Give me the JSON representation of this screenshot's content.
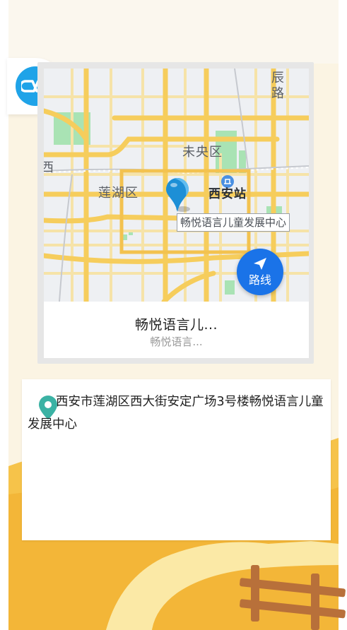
{
  "app": {
    "logo_icon": "infinity-loop-icon",
    "brand_color": "#1fa3e8"
  },
  "map": {
    "district_labels": [
      "未央区",
      "莲湖区"
    ],
    "road_label": "辰路",
    "edge_label": "西",
    "station_label": "西安站",
    "poi_callout": "畅悦语言儿童发展中心",
    "route_button_label": "路线",
    "route_button_color": "#1a73e8",
    "marker_icon": "map-marker-icon"
  },
  "place": {
    "title": "畅悦语言儿...",
    "subtitle": "畅悦语言..."
  },
  "address": {
    "icon": "location-pin-icon",
    "pin_color": "#3bb2a4",
    "text": "西安市莲湖区西大街安定广场3号楼畅悦语言儿童发展中心"
  }
}
